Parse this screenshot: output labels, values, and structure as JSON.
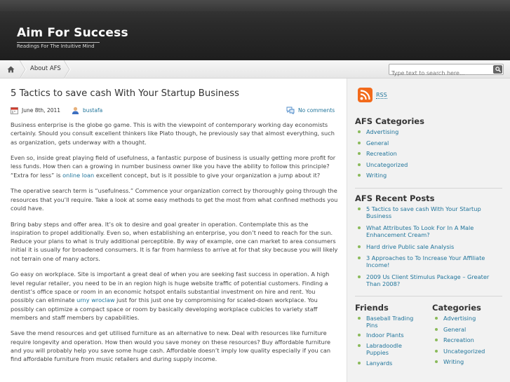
{
  "site": {
    "title": "Aim For Success",
    "tagline": "Readings For The Intuitive Mind"
  },
  "nav": {
    "home_icon": "home-icon",
    "items": [
      "About AFS"
    ],
    "search_placeholder": "Type text to search here...",
    "search_icon": "magnifier-icon"
  },
  "post": {
    "title": "5 Tactics to save cash With Your Startup Business",
    "date": "June 8th, 2011",
    "author": "bustafa",
    "comments": "No comments",
    "paragraphs": [
      {
        "a": "Business enterprise is the globe go game. This is with the viewpoint of contemporary working day economists certainly. Should you consult excellent thinkers like Plato though, he previously say that almost everything, such as organization, gets underway with a thought."
      },
      {
        "a": "Even so, inside great playing field of usefulness, a fantastic purpose of business is usually getting more profit for less funds. How then can a growing in number business owner like you have the ability to follow this principle? “Extra for less” is ",
        "link": "online loan",
        "b": " excellent concept, but is it possible to give your organization a jump about it?"
      },
      {
        "a": "The operative search term is “usefulness.” Commence your organization correct by thoroughly going through the resources that you’ll require. Take a look at some easy methods to get the most from what confined methods you could have."
      },
      {
        "a": "Bring baby steps and offer area. It’s ok to desire and goal greater in operation. Contemplate this as the inspiration to propel additionally. Even so, when establishing an enterprise, you don’t need to reach for the sun. Reduce your plans to what is truly additional perceptible. By way of example, one can market to area consumers initial it is usually for broadened consumers. It is far from harmless to arrive at for that sky because you will likely not terrain one of many actors."
      },
      {
        "a": "Go easy on workplace. Site is important a great deal of when you are seeking fast success in operation. A high level regular retailer, you need to be in an region high is huge website traffic of potential customers. Finding a dentist’s office space or room in an economic hotspot entails substantial investment on hire and rent. You possibly can eliminate ",
        "link": "urny wroclaw",
        "b": " just for this just one by compromising for scaled-down workplace. You possibly can optimize a compact space or room by basically developing workplace cubicles to variety staff members and staff members by capabilities."
      },
      {
        "a": "Save the mend resources and get utilised furniture as an alternative to new. Deal with resources like furniture require longevity and operation. How then would you save money on these resources? Buy affordable furniture and you will probably help you save some huge cash. Affordable doesn’t imply low quality especially if you can find affordable furniture from music retailers and during supply income."
      }
    ]
  },
  "sidebar": {
    "rss_label": "RSS",
    "categories_title": "AFS Categories",
    "categories": [
      "Advertising",
      "General",
      "Recreation",
      "Uncategorized",
      "Writing"
    ],
    "recent_title": "AFS Recent Posts",
    "recent": [
      "5 Tactics to save cash With Your Startup Business",
      "What Attributes To Look For In A Male Enhancement Cream?",
      "Hard drive Public sale Analysis",
      "3 Approaches to To Increase Your Affiliate Income!",
      "2009 Us Client Stimulus Package – Greater Than 2008?"
    ],
    "friends_title": "Friends",
    "friends": [
      "Baseball Trading Pins",
      "Indoor Plants",
      "Labradoodle Puppies",
      "Lanyards"
    ],
    "categories2_title": "Categories",
    "categories2": [
      "Advertising",
      "General",
      "Recreation",
      "Uncategorized",
      "Writing"
    ]
  },
  "colors": {
    "link": "#21759b",
    "header_bg": "#2b2b2b",
    "bullet": "#8aba5a",
    "rss": "#f26a1b"
  }
}
